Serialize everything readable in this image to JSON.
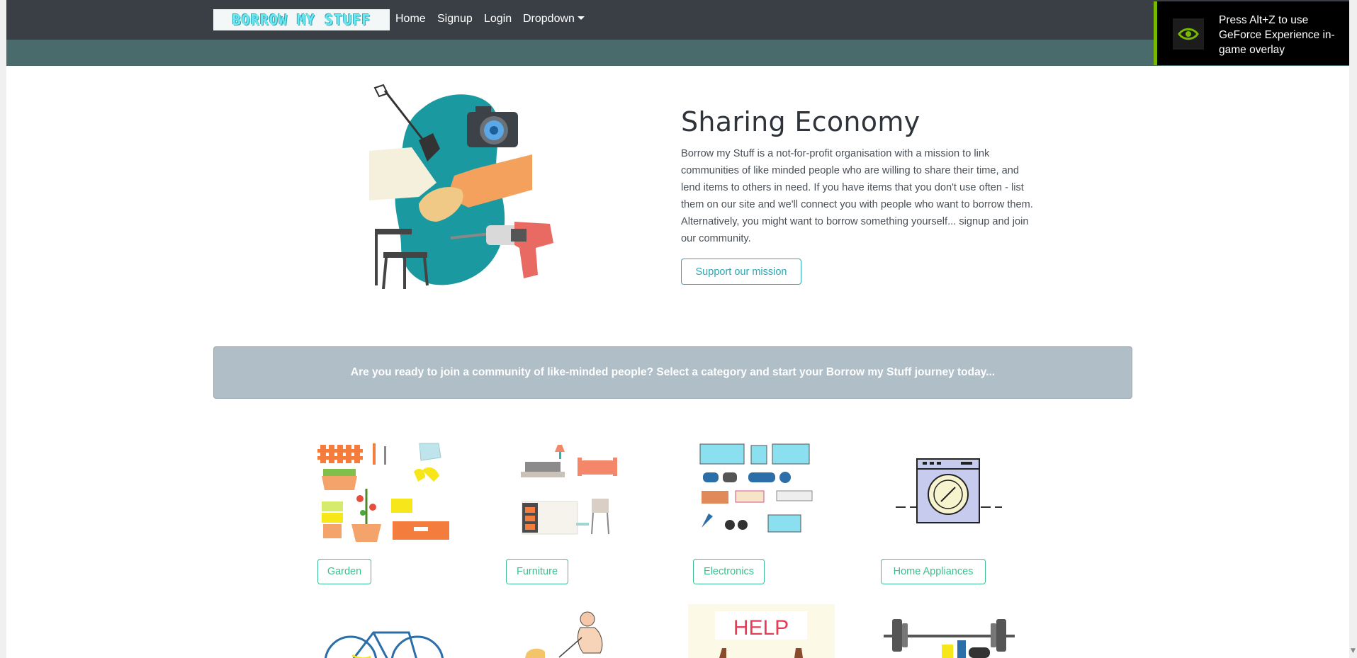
{
  "navbar": {
    "logo_text": "BORROW MY STUFF",
    "items": [
      {
        "label": "Home"
      },
      {
        "label": "Signup"
      },
      {
        "label": "Login"
      },
      {
        "label": "Dropdown"
      }
    ]
  },
  "overlay": {
    "message": "Press Alt+Z to use GeForce Experience in-game overlay"
  },
  "hero": {
    "title": "Sharing Economy",
    "body": "Borrow my Stuff is a not-for-profit organisation with a mission to link communities of like minded people who are willing to share their time, and lend items to others in need. If you have items that you don't use often - list them on our site and we'll connect you with people who want to borrow them. Alternatively, you might want to borrow something yourself... signup and join our community.",
    "button_label": "Support our mission"
  },
  "banner": {
    "text": "Are you ready to join a community of like-minded people? Select a category and start your Borrow my Stuff journey today..."
  },
  "categories": [
    {
      "label": "Garden",
      "icon": "garden-tools-image"
    },
    {
      "label": "Furniture",
      "icon": "furniture-image"
    },
    {
      "label": "Electronics",
      "icon": "electronics-image"
    },
    {
      "label": "Home Appliances",
      "icon": "washing-machine-image"
    }
  ],
  "second_row": {
    "help_sign": "HELP"
  },
  "colors": {
    "navbar": "#3a3f45",
    "nav_accent": "#4a6b6c",
    "accent_teal": "#2aa9b8",
    "category_green": "#3bbf8c",
    "banner": "#b0bec8",
    "nvidia_green": "#76b900"
  }
}
